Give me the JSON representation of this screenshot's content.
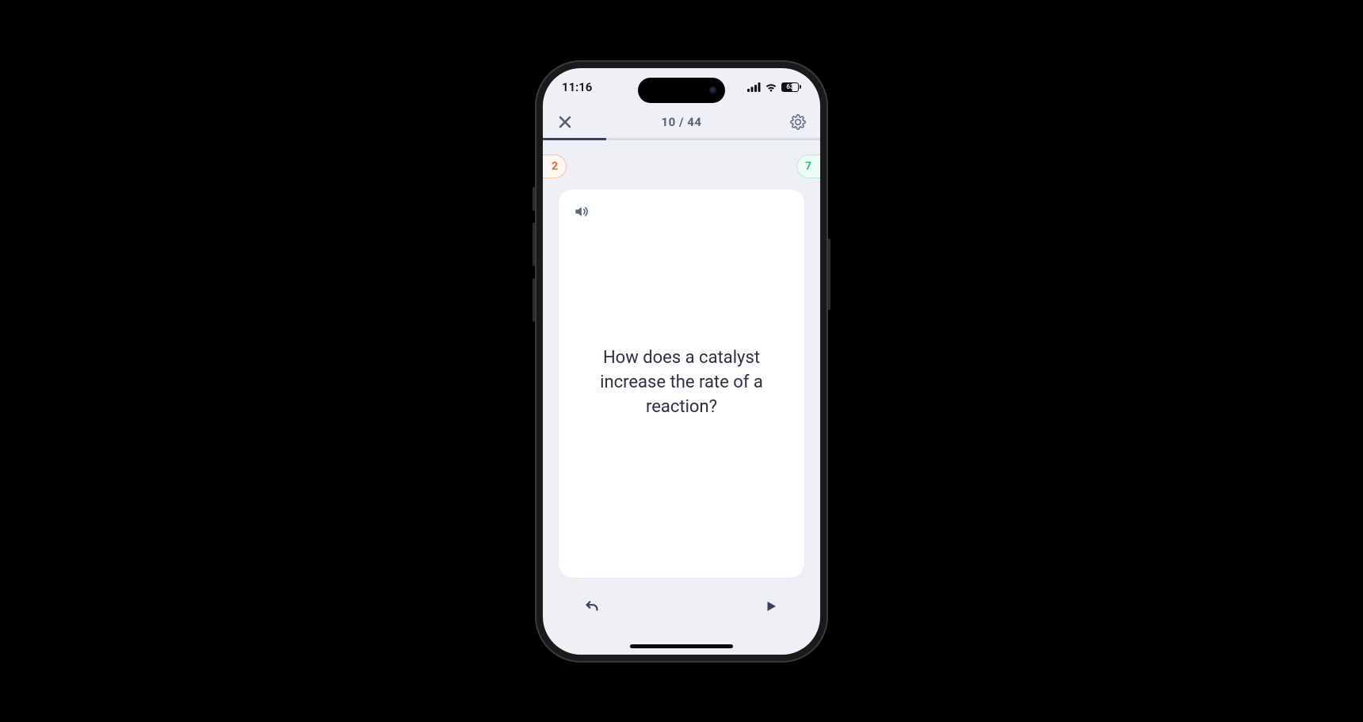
{
  "status_bar": {
    "time": "11:16",
    "battery_percent": "63"
  },
  "header": {
    "counter": "10 / 44"
  },
  "progress": {
    "current": 10,
    "total": 44
  },
  "scores": {
    "wrong": "2",
    "correct": "7"
  },
  "card": {
    "question": "How does a catalyst increase the rate of a reaction?"
  }
}
